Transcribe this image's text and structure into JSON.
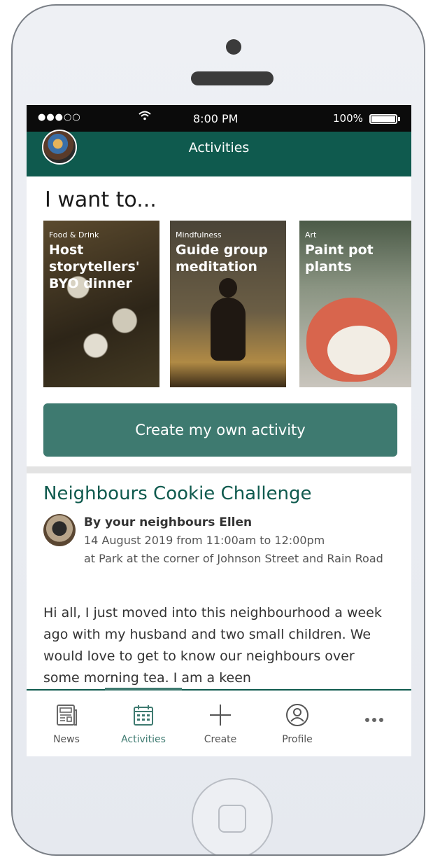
{
  "status_bar": {
    "signal": "●●●○○",
    "wifi": "wifi-icon",
    "time": "8:00 PM",
    "battery": "100%"
  },
  "header": {
    "title": "Activities"
  },
  "section": {
    "heading": "I want to..."
  },
  "cards": [
    {
      "category": "Food & Drink",
      "title": "Host storytellers' BYO dinner"
    },
    {
      "category": "Mindfulness",
      "title": "Guide group meditation"
    },
    {
      "category": "Art",
      "title": "Paint pot plants"
    }
  ],
  "create_button": {
    "label": "Create my own activity"
  },
  "event": {
    "title": "Neighbours Cookie Challenge",
    "author": "By your neighbours Ellen",
    "date": "14 August 2019 from 11:00am to 12:00pm",
    "location": "at Park at the corner of Johnson Street and Rain Road",
    "body": "Hi all, I just moved into this neighbourhood a week ago with my husband and two small children. We would love to get to know our neighbours over some morning tea. I am a keen"
  },
  "tabs": [
    {
      "label": "News",
      "icon": "newspaper-icon"
    },
    {
      "label": "Activities",
      "icon": "calendar-icon",
      "active": true
    },
    {
      "label": "Create",
      "icon": "plus-icon"
    },
    {
      "label": "Profile",
      "icon": "profile-icon"
    },
    {
      "label": "",
      "icon": "more-icon"
    }
  ],
  "colors": {
    "primary": "#0f5a4e",
    "button": "#3e7a70",
    "status_bar": "#0b0b0b"
  }
}
